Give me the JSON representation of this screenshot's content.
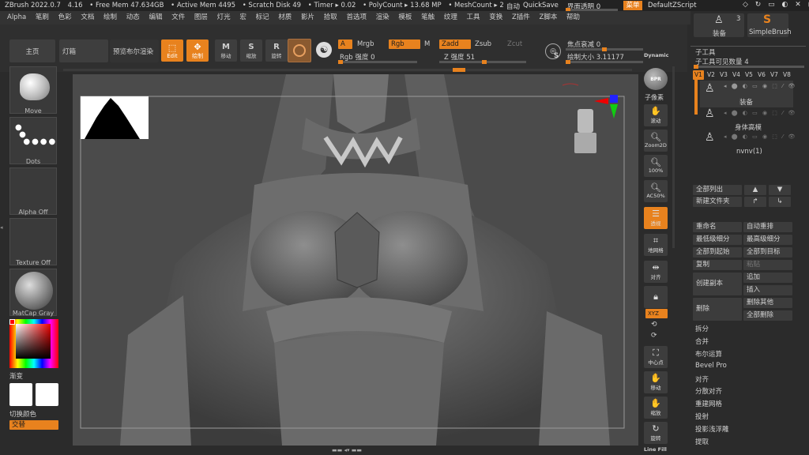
{
  "titlebar": {
    "items": [
      "ZBrush 2022.0.7",
      "4.16",
      "• Free Mem 47.634GB",
      "• Active Mem 4495",
      "• Scratch Disk 49",
      "• Timer ▸ 0.02",
      "• PolyCount ▸ 13.68 MP",
      "• MeshCount ▸ 2"
    ],
    "auto": "自动",
    "quicksave": "QuickSave",
    "transparency": "界面透明 0",
    "menu": "菜单",
    "script": "DefaultZScript"
  },
  "menubar": [
    "Alpha",
    "笔刷",
    "色彩",
    "文档",
    "绘制",
    "动态",
    "编辑",
    "文件",
    "图层",
    "灯光",
    "宏",
    "标记",
    "材质",
    "影片",
    "拾取",
    "首选项",
    "渲染",
    "模板",
    "笔触",
    "纹理",
    "工具",
    "变换",
    "Z插件",
    "Z脚本",
    "帮助"
  ],
  "shelf": {
    "home": "主页",
    "lightbox": "灯箱",
    "preview_bool": "预览布尔渲染",
    "edit": "Edit",
    "draw": "绘制",
    "move": "移动",
    "scale": "缩放",
    "rotate": "旋转",
    "a": "A",
    "mrgb": "Mrgb",
    "rgb": "Rgb",
    "m": "M",
    "zadd": "Zadd",
    "zsub": "Zsub",
    "zcut": "Zcut",
    "rgb_intensity": "Rgb 强度 0",
    "z_intensity": "Z 强度 51",
    "focal": "焦点衰减 0",
    "draw_size": "绘制大小 3.11177",
    "dynamic": "Dynamic",
    "s": "S"
  },
  "left": {
    "move": "Move",
    "dots": "Dots",
    "alpha": "Alpha Off",
    "texture": "Texture Off",
    "matcap": "MatCap Gray",
    "gradient": "渐变",
    "switch_color": "切换颜色",
    "alternate": "交替"
  },
  "right_shelf": {
    "bpr": "BPR",
    "subpixel": "子像素",
    "scroll": "滚动",
    "zoom2d": "Zoom2D",
    "p100": "100%",
    "ac50": "AC50%",
    "persp": "透视",
    "floor": "地网格",
    "local": "对齐",
    "lock": "",
    "xyz": "XYZ",
    "frame": "中心点",
    "move": "移动",
    "scale": "缩放",
    "rotate": "旋转",
    "linefill": "Line Fill"
  },
  "right_panel": {
    "top_count": "3",
    "equip": "装备",
    "simplebrush": "SimpleBrush",
    "subtool": "子工具",
    "visible_count": "子工具可见数量 4",
    "versions": [
      "V1",
      "V2",
      "V3",
      "V4",
      "V5",
      "V6",
      "V7",
      "V8"
    ],
    "items": [
      "装备",
      "身体高模",
      "nvnv(1)"
    ],
    "list_all": "全部列出",
    "new_folder": "新建文件夹",
    "rename": "重命名",
    "auto_reorder": "自动重排",
    "lowest_sub": "最低级细分",
    "highest_sub": "最高级细分",
    "all_to_start": "全部到起始",
    "all_to_target": "全部到目标",
    "copy": "复制",
    "paste": "粘贴",
    "create_dup": "创建副本",
    "append": "追加",
    "insert": "插入",
    "delete": "删除",
    "del_other": "删除其他",
    "del_all": "全部删除",
    "split": "拆分",
    "merge": "合并",
    "boolean": "布尔运算",
    "bevel": "Bevel Pro",
    "align": "对齐",
    "distribute": "分散对齐",
    "remesh": "重建网格",
    "project": "投射",
    "project_shallow": "投影浅浮雕",
    "extract": "提取"
  },
  "colors": {
    "accent": "#e8821e",
    "bg": "#2b2b2b",
    "panel": "#3c3c3c"
  }
}
